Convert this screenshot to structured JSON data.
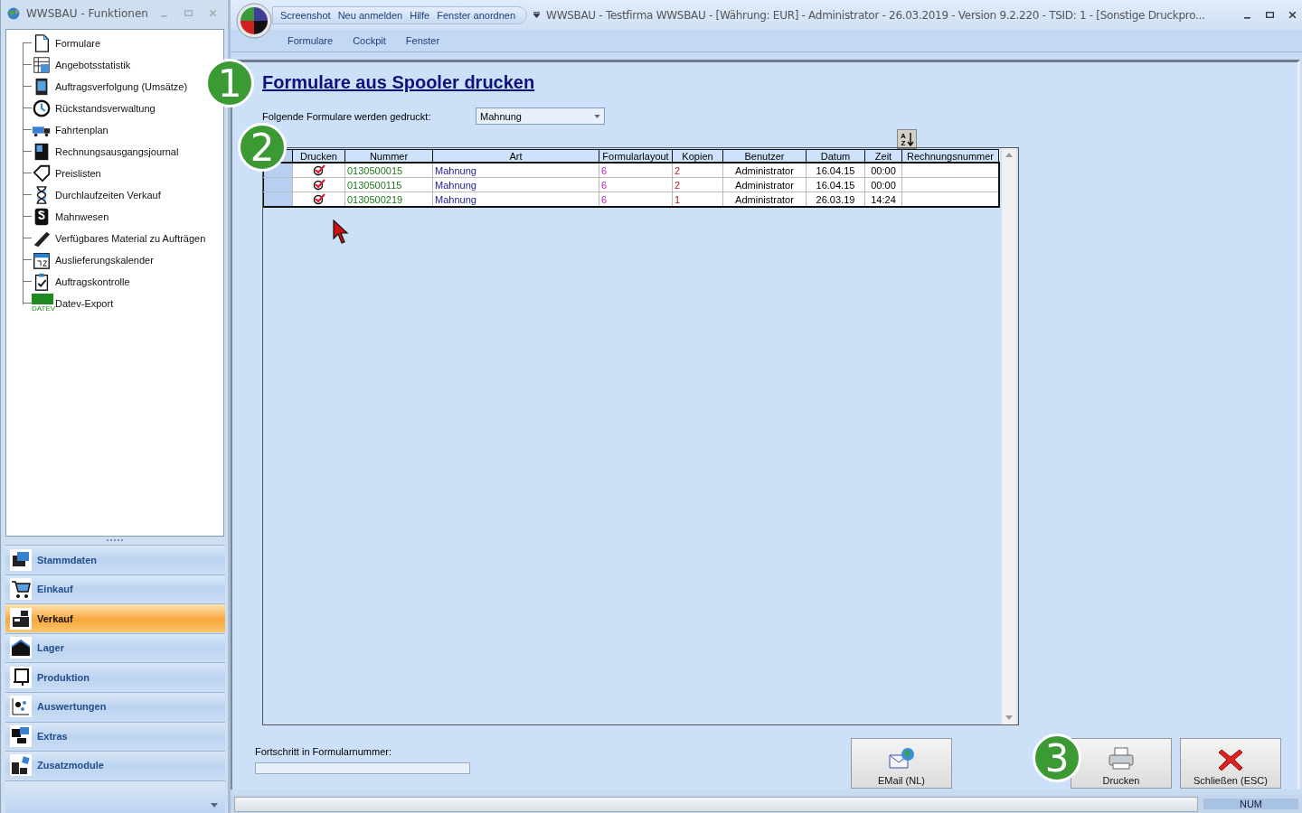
{
  "side_window": {
    "title": "WWSBAU - Funktionen",
    "tree_items": [
      {
        "label": "Formulare"
      },
      {
        "label": "Angebotsstatistik"
      },
      {
        "label": "Auftragsverfolgung (Umsätze)"
      },
      {
        "label": "Rückstandsverwaltung"
      },
      {
        "label": "Fahrtenplan"
      },
      {
        "label": "Rechnungsausgangsjournal"
      },
      {
        "label": "Preislisten"
      },
      {
        "label": "Durchlaufzeiten Verkauf"
      },
      {
        "label": "Mahnwesen"
      },
      {
        "label": "Verfügbares Material zu Aufträgen"
      },
      {
        "label": "Auslieferungskalender"
      },
      {
        "label": "Auftragskontrolle"
      },
      {
        "label": "Datev-Export",
        "icon_text": "DATEV"
      }
    ],
    "nav": [
      {
        "label": "Stammdaten",
        "selected": false
      },
      {
        "label": "Einkauf",
        "selected": false
      },
      {
        "label": "Verkauf",
        "selected": true
      },
      {
        "label": "Lager",
        "selected": false
      },
      {
        "label": "Produktion",
        "selected": false
      },
      {
        "label": "Auswertungen",
        "selected": false
      },
      {
        "label": "Extras",
        "selected": false
      },
      {
        "label": "Zusatzmodule",
        "selected": false
      }
    ]
  },
  "main_window": {
    "quick_access": [
      "Screenshot",
      "Neu anmelden",
      "Hilfe",
      "Fenster anordnen"
    ],
    "title": "WWSBAU - Testfirma WWSBAU - [Währung: EUR] - Administrator - 26.03.2019 - Version 9.2.220 - TSID: 1  - [Sonstige Druckpro...",
    "ribbon_tabs": [
      "Formulare",
      "Cockpit",
      "Fenster"
    ]
  },
  "form": {
    "heading": "Formulare aus Spooler drucken",
    "filter_label": "Folgende Formulare werden gedruckt:",
    "filter_value": "Mahnung",
    "sort_button": {
      "top_letter": "A",
      "bottom_letter": "Z"
    },
    "table": {
      "columns": [
        "Drucken",
        "Nummer",
        "Art",
        "Formularlayout",
        "Kopien",
        "Benutzer",
        "Datum",
        "Zeit",
        "Rechnungsnummer"
      ],
      "rows": [
        {
          "checked": true,
          "cells": [
            "",
            "0130500015",
            "Mahnung",
            "6",
            "2",
            "Administrator",
            "16.04.15",
            "00:00"
          ]
        },
        {
          "checked": true,
          "cells": [
            "",
            "0130500115",
            "Mahnung",
            "6",
            "2",
            "Administrator",
            "16.04.15",
            "00:00"
          ]
        },
        {
          "checked": true,
          "cells": [
            "",
            "0130500219",
            "Mahnung",
            "6",
            "1",
            "Administrator",
            "26.03.19",
            "14:24"
          ]
        }
      ]
    },
    "progress_label": "Fortschritt in Formularnummer:",
    "progress": {
      "level": 0
    },
    "buttons": [
      {
        "kind": "email",
        "label": "EMail (NL)"
      },
      {
        "kind": "print",
        "label": "Drucken"
      },
      {
        "kind": "close",
        "label": "Schließen (ESC)"
      }
    ]
  },
  "callouts": [
    "1",
    "2",
    "3"
  ],
  "status_bar": {
    "indicator": "NUM"
  }
}
